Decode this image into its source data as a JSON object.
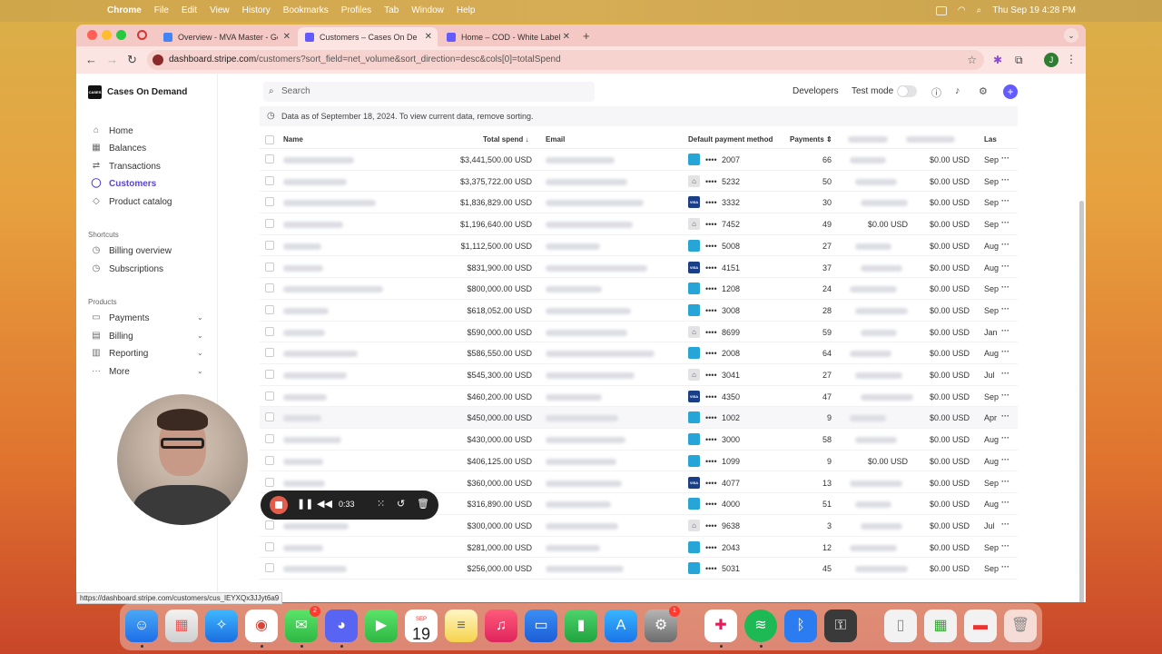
{
  "menubar": {
    "app": "Chrome",
    "items": [
      "File",
      "Edit",
      "View",
      "History",
      "Bookmarks",
      "Profiles",
      "Tab",
      "Window",
      "Help"
    ],
    "clock": "Thu Sep 19  4:28 PM"
  },
  "browser": {
    "tabs": [
      {
        "title": "Overview - MVA Master - Go",
        "favicon_color": "#4285f4"
      },
      {
        "title": "Customers – Cases On De",
        "favicon_color": "#635bff"
      },
      {
        "title": "Home – COD - White Label -",
        "favicon_color": "#635bff"
      }
    ],
    "url_host": "dashboard.stripe.com",
    "url_rest": "/customers?sort_field=net_volume&sort_direction=desc&cols[0]=totalSpend",
    "profile_initial": "J",
    "status_url": "https://dashboard.stripe.com/customers/cus_lEYXQx3JJyt6a9"
  },
  "sidebar": {
    "brand": "Cases On Demand",
    "brand_logo_text": "CASES",
    "main_items": [
      {
        "label": "Home",
        "icon": "home-icon"
      },
      {
        "label": "Balances",
        "icon": "balances-icon"
      },
      {
        "label": "Transactions",
        "icon": "transactions-icon"
      },
      {
        "label": "Customers",
        "icon": "customers-icon"
      },
      {
        "label": "Product catalog",
        "icon": "product-catalog-icon"
      }
    ],
    "shortcuts_label": "Shortcuts",
    "shortcuts": [
      {
        "label": "Billing overview",
        "icon": "clock-icon"
      },
      {
        "label": "Subscriptions",
        "icon": "clock-icon"
      }
    ],
    "products_label": "Products",
    "products": [
      {
        "label": "Payments",
        "icon": "payments-icon"
      },
      {
        "label": "Billing",
        "icon": "billing-icon"
      },
      {
        "label": "Reporting",
        "icon": "reporting-icon"
      },
      {
        "label": "More",
        "icon": "more-icon"
      }
    ]
  },
  "header": {
    "search_placeholder": "Search",
    "developers": "Developers",
    "test_mode": "Test mode"
  },
  "banner": "Data as of September 18, 2024. To view current data, remove sorting.",
  "table": {
    "columns": {
      "name": "Name",
      "total_spend": "Total spend ↓",
      "email": "Email",
      "payment_method": "Default payment method",
      "payments": "Payments ⇕",
      "last": "Las"
    },
    "rows": [
      {
        "spend": "$3,441,500.00 USD",
        "card_type": "generic",
        "last4": "2007",
        "payments": "66",
        "refunds": "",
        "disputes": "$0.00 USD",
        "last": "Sep"
      },
      {
        "spend": "$3,375,722.00 USD",
        "card_type": "bank",
        "last4": "5232",
        "payments": "50",
        "refunds": "",
        "disputes": "$0.00 USD",
        "last": "Sep"
      },
      {
        "spend": "$1,836,829.00 USD",
        "card_type": "visa",
        "last4": "3332",
        "payments": "30",
        "refunds": "",
        "disputes": "$0.00 USD",
        "last": "Sep"
      },
      {
        "spend": "$1,196,640.00 USD",
        "card_type": "bank",
        "last4": "7452",
        "payments": "49",
        "refunds": "$0.00 USD",
        "disputes": "$0.00 USD",
        "last": "Sep"
      },
      {
        "spend": "$1,112,500.00 USD",
        "card_type": "generic",
        "last4": "5008",
        "payments": "27",
        "refunds": "",
        "disputes": "$0.00 USD",
        "last": "Aug"
      },
      {
        "spend": "$831,900.00 USD",
        "card_type": "visa",
        "last4": "4151",
        "payments": "37",
        "refunds": "",
        "disputes": "$0.00 USD",
        "last": "Aug"
      },
      {
        "spend": "$800,000.00 USD",
        "card_type": "generic",
        "last4": "1208",
        "payments": "24",
        "refunds": "",
        "disputes": "$0.00 USD",
        "last": "Sep"
      },
      {
        "spend": "$618,052.00 USD",
        "card_type": "generic",
        "last4": "3008",
        "payments": "28",
        "refunds": "",
        "disputes": "$0.00 USD",
        "last": "Sep"
      },
      {
        "spend": "$590,000.00 USD",
        "card_type": "bank",
        "last4": "8699",
        "payments": "59",
        "refunds": "",
        "disputes": "$0.00 USD",
        "last": "Jan"
      },
      {
        "spend": "$586,550.00 USD",
        "card_type": "generic",
        "last4": "2008",
        "payments": "64",
        "refunds": "",
        "disputes": "$0.00 USD",
        "last": "Aug"
      },
      {
        "spend": "$545,300.00 USD",
        "card_type": "bank",
        "last4": "3041",
        "payments": "27",
        "refunds": "",
        "disputes": "$0.00 USD",
        "last": "Jul"
      },
      {
        "spend": "$460,200.00 USD",
        "card_type": "visa",
        "last4": "4350",
        "payments": "47",
        "refunds": "",
        "disputes": "$0.00 USD",
        "last": "Sep"
      },
      {
        "spend": "$450,000.00 USD",
        "card_type": "generic",
        "last4": "1002",
        "payments": "9",
        "refunds": "",
        "disputes": "$0.00 USD",
        "last": "Apr"
      },
      {
        "spend": "$430,000.00 USD",
        "card_type": "generic",
        "last4": "3000",
        "payments": "58",
        "refunds": "",
        "disputes": "$0.00 USD",
        "last": "Aug"
      },
      {
        "spend": "$406,125.00 USD",
        "card_type": "generic",
        "last4": "1099",
        "payments": "9",
        "refunds": "$0.00 USD",
        "disputes": "$0.00 USD",
        "last": "Aug"
      },
      {
        "spend": "$360,000.00 USD",
        "card_type": "visa",
        "last4": "4077",
        "payments": "13",
        "refunds": "",
        "disputes": "$0.00 USD",
        "last": "Sep"
      },
      {
        "spend": "$316,890.00 USD",
        "card_type": "generic",
        "last4": "4000",
        "payments": "51",
        "refunds": "",
        "disputes": "$0.00 USD",
        "last": "Aug"
      },
      {
        "spend": "$300,000.00 USD",
        "card_type": "bank",
        "last4": "9638",
        "payments": "3",
        "refunds": "",
        "disputes": "$0.00 USD",
        "last": "Jul"
      },
      {
        "spend": "$281,000.00 USD",
        "card_type": "generic",
        "last4": "2043",
        "payments": "12",
        "refunds": "",
        "disputes": "$0.00 USD",
        "last": "Sep"
      },
      {
        "spend": "$256,000.00 USD",
        "card_type": "generic",
        "last4": "5031",
        "payments": "45",
        "refunds": "",
        "disputes": "$0.00 USD",
        "last": "Sep"
      }
    ],
    "card_dots": "••••",
    "visa_text": "VISA",
    "more_glyph": "···"
  },
  "recorder": {
    "time": "0:33"
  },
  "dock": {
    "calendar_month": "SEP",
    "calendar_day": "19",
    "messages_badge": "2",
    "settings_badge": "1"
  }
}
